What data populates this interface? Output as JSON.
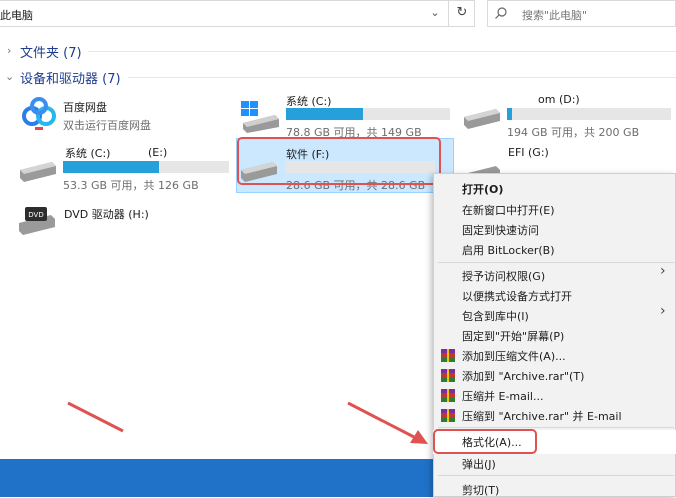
{
  "address": {
    "text": "此电脑"
  },
  "search": {
    "placeholder": "搜索\"此电脑\""
  },
  "groups": {
    "folders": "文件夹 (7)",
    "devices": "设备和驱动器 (7)"
  },
  "items": {
    "baidu": {
      "name": "百度网盘",
      "sub": "双击运行百度网盘"
    },
    "c1": {
      "name": "系统 (C:)",
      "size": "78.8 GB 可用，共 149 GB",
      "fill": 0.47
    },
    "d": {
      "name": "om (D:)",
      "size": "194 GB 可用，共 200 GB",
      "fill": 0.03
    },
    "c2": {
      "name": "系统 (C:)",
      "name2": "(E:)",
      "size": "53.3 GB 可用，共 126 GB",
      "fill": 0.58
    },
    "f": {
      "name": "软件 (F:)",
      "size": "28.6 GB 可用，共 28.6 GB",
      "fill": 0.0
    },
    "g": {
      "name": "EFI (G:)"
    },
    "h": {
      "name": "DVD 驱动器 (H:)",
      "badge": "DVD"
    }
  },
  "menu": {
    "open": "打开(O)",
    "open_new": "在新窗口中打开(E)",
    "pin_quick": "固定到快速访问",
    "bitlocker": "启用 BitLocker(B)",
    "grant": "授予访问权限(G)",
    "portable": "以便携式设备方式打开",
    "library": "包含到库中(I)",
    "pin_start": "固定到\"开始\"屏幕(P)",
    "add_archive": "添加到压缩文件(A)...",
    "add_rar": "添加到 \"Archive.rar\"(T)",
    "compress_email": "压缩并 E-mail...",
    "compress_rar_email": "压缩到 \"Archive.rar\" 并 E-mail",
    "format": "格式化(A)...",
    "eject": "弹出(J)",
    "cut": "剪切(T)"
  },
  "colors": {
    "accent": "#26a0da",
    "annotation": "#e05252",
    "taskbar": "#2072c8",
    "selection": "#cce8ff"
  },
  "icons": [
    "chevron-down-icon",
    "refresh-icon",
    "search-icon",
    "baidu-netdisk-icon",
    "windows-drive-icon",
    "drive-icon",
    "dvd-drive-icon",
    "winrar-icon",
    "submenu-arrow-icon"
  ]
}
